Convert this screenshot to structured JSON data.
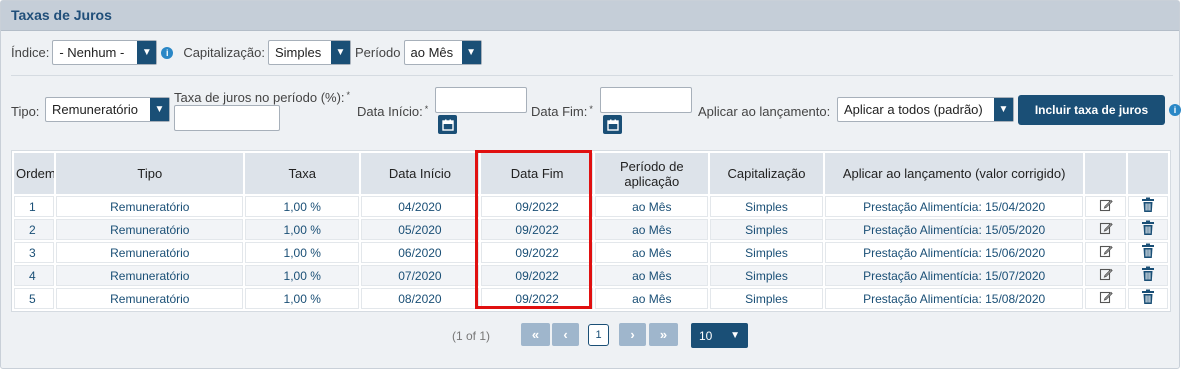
{
  "panel": {
    "title": "Taxas de Juros"
  },
  "filters": {
    "indice": {
      "label": "Índice:",
      "value": "- Nenhum -"
    },
    "capitalizacao": {
      "label": "Capitalização:",
      "value": "Simples"
    },
    "periodo": {
      "label": "Período",
      "value": "ao Mês"
    }
  },
  "form": {
    "tipo": {
      "label": "Tipo:",
      "value": "Remuneratório"
    },
    "taxa": {
      "label": "Taxa de juros no período (%):",
      "required": "*",
      "value": ""
    },
    "data_inicio": {
      "label": "Data Início:",
      "required": "*",
      "value": ""
    },
    "data_fim": {
      "label": "Data Fim:",
      "required": "*",
      "value": ""
    },
    "aplicar": {
      "label": "Aplicar ao lançamento:",
      "value": "Aplicar a todos (padrão)"
    },
    "include_button": "Incluir taxa de juros"
  },
  "table": {
    "headers": {
      "ordem": "Ordem",
      "tipo": "Tipo",
      "taxa": "Taxa",
      "data_inicio": "Data Início",
      "data_fim": "Data Fim",
      "periodo": "Período de aplicação",
      "capitalizacao": "Capitalização",
      "aplicar": "Aplicar ao lançamento (valor corrigido)"
    },
    "rows": [
      {
        "ordem": "1",
        "tipo": "Remuneratório",
        "taxa": "1,00 %",
        "data_inicio": "04/2020",
        "data_fim": "09/2022",
        "periodo": "ao Mês",
        "capitalizacao": "Simples",
        "aplicar": "Prestação Alimentícia: 15/04/2020"
      },
      {
        "ordem": "2",
        "tipo": "Remuneratório",
        "taxa": "1,00 %",
        "data_inicio": "05/2020",
        "data_fim": "09/2022",
        "periodo": "ao Mês",
        "capitalizacao": "Simples",
        "aplicar": "Prestação Alimentícia: 15/05/2020"
      },
      {
        "ordem": "3",
        "tipo": "Remuneratório",
        "taxa": "1,00 %",
        "data_inicio": "06/2020",
        "data_fim": "09/2022",
        "periodo": "ao Mês",
        "capitalizacao": "Simples",
        "aplicar": "Prestação Alimentícia: 15/06/2020"
      },
      {
        "ordem": "4",
        "tipo": "Remuneratório",
        "taxa": "1,00 %",
        "data_inicio": "07/2020",
        "data_fim": "09/2022",
        "periodo": "ao Mês",
        "capitalizacao": "Simples",
        "aplicar": "Prestação Alimentícia: 15/07/2020"
      },
      {
        "ordem": "5",
        "tipo": "Remuneratório",
        "taxa": "1,00 %",
        "data_inicio": "08/2020",
        "data_fim": "09/2022",
        "periodo": "ao Mês",
        "capitalizacao": "Simples",
        "aplicar": "Prestação Alimentícia: 15/08/2020"
      }
    ],
    "row_icons": {
      "edit": "edit-icon",
      "delete": "trash-icon"
    }
  },
  "pagination": {
    "info": "(1 of 1)",
    "current_page": "1",
    "page_size": "10"
  },
  "colors": {
    "accent": "#1a4f76",
    "header_bg": "#c5ced8",
    "highlight": "#e01010"
  }
}
